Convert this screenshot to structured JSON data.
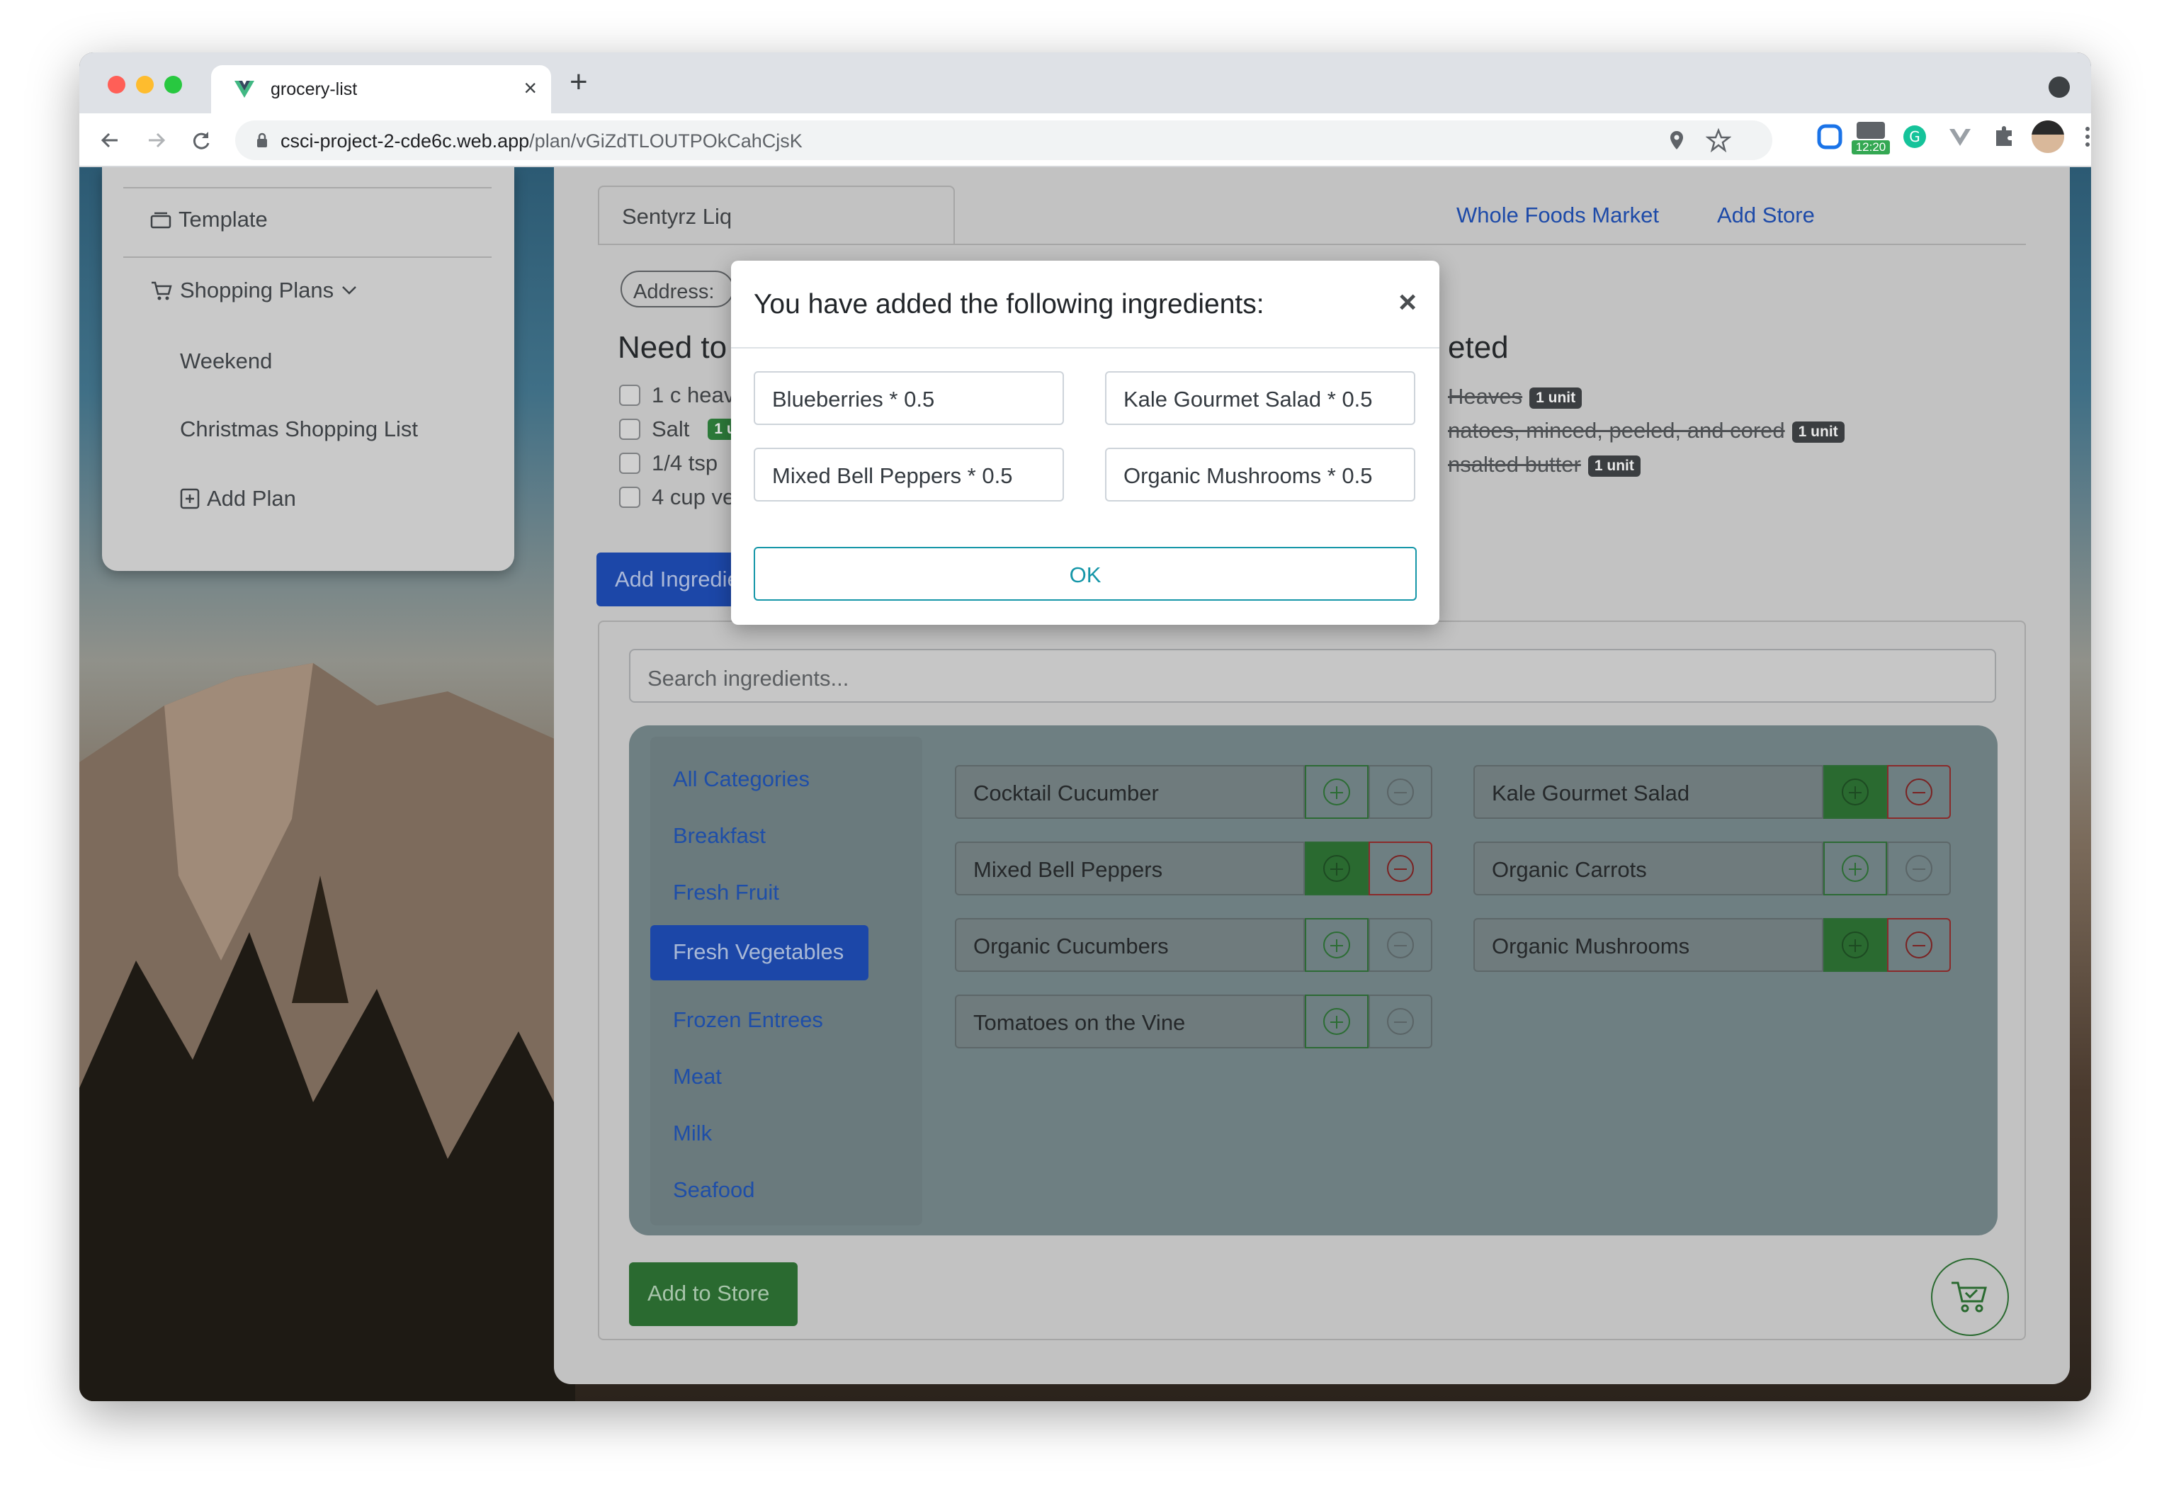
{
  "browser": {
    "tab_title": "grocery-list",
    "url_host": "csci-project-2-cde6c.web.app",
    "url_path": "/plan/vGiZdTLOUTPOkCahCjsK",
    "ext_badge": "12:20"
  },
  "sidebar": {
    "template": "Template",
    "shopping_plans": "Shopping Plans",
    "plans": [
      "Weekend",
      "Christmas Shopping List"
    ],
    "add_plan": "Add Plan"
  },
  "stores": {
    "active": "Sentyrz Liq",
    "others": [
      "Whole Foods Market",
      "Add Store"
    ]
  },
  "address_label": "Address:",
  "need_heading": "Need to",
  "completed_heading_fragment": "eted",
  "need_items": [
    "1 c heav",
    "Salt",
    "1/4 tsp",
    "4 cup ve"
  ],
  "completed_items": [
    {
      "text": "Heaves",
      "badge": "1 unit"
    },
    {
      "text": "natoes, minced, peeled, and cored",
      "badge": "1 unit"
    },
    {
      "text": "nsalted butter",
      "badge": "1 unit"
    }
  ],
  "salt_badge": "1 un",
  "add_ingredients": "Add Ingredients",
  "search_placeholder": "Search ingredients...",
  "categories": [
    "All Categories",
    "Breakfast",
    "Fresh Fruit",
    "Fresh Vegetables",
    "Frozen Entrees",
    "Meat",
    "Milk",
    "Seafood"
  ],
  "active_category": "Fresh Vegetables",
  "ingredients": [
    {
      "name": "Cocktail Cucumber",
      "added": false
    },
    {
      "name": "Kale Gourmet Salad",
      "added": true
    },
    {
      "name": "Mixed Bell Peppers",
      "added": true
    },
    {
      "name": "Organic Carrots",
      "added": false
    },
    {
      "name": "Organic Cucumbers",
      "added": false
    },
    {
      "name": "Organic Mushrooms",
      "added": true
    },
    {
      "name": "Tomatoes on the Vine",
      "added": false
    }
  ],
  "add_to_store": "Add to Store",
  "modal": {
    "title": "You have added the following ingredients:",
    "items": [
      "Blueberries * 0.5",
      "Kale Gourmet Salad * 0.5",
      "Mixed Bell Peppers * 0.5",
      "Organic Mushrooms * 0.5"
    ],
    "ok": "OK"
  }
}
